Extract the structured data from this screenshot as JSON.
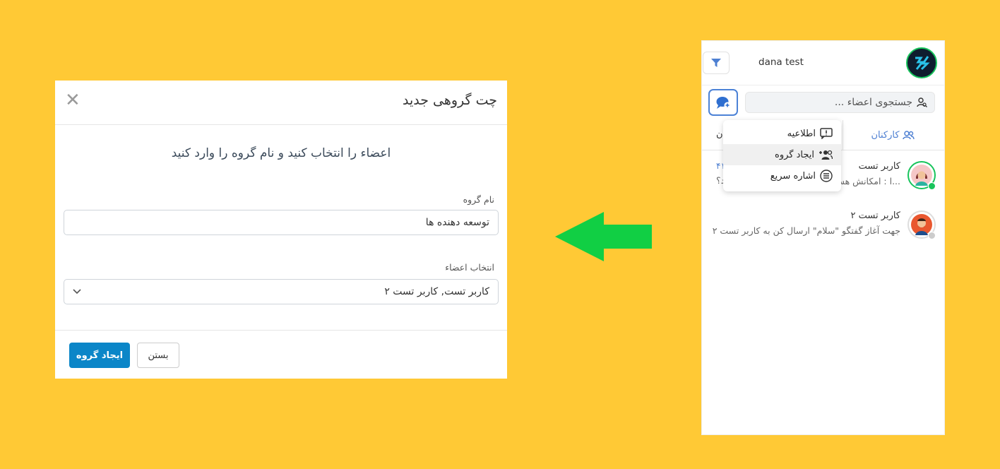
{
  "modal": {
    "title": "چت گروهی جدید",
    "instruction": "اعضاء را انتخاب کنید و نام گروه را وارد کنید",
    "group_name_label": "نام گروه",
    "group_name_value": "توسعه دهنده ها",
    "members_label": "انتخاب اعضاء",
    "members_value": "کاربر تست,  کاربر تست ۲",
    "create_button": "ایجاد گروه",
    "close_button": "بستن"
  },
  "panel": {
    "user_name": "dana test",
    "search_placeholder": "جستجوی اعضاء ...",
    "tab_staff": "کارکنان",
    "tab_other": "ن",
    "menu": [
      {
        "label": "اطلاعیه",
        "icon": "announcement-icon"
      },
      {
        "label": "ایجاد گروه",
        "icon": "add-group-icon"
      },
      {
        "label": "اشاره سریع",
        "icon": "list-icon"
      }
    ],
    "contacts": [
      {
        "name": "کاربر تست",
        "message": "...ا : امکانش هس",
        "extra_top": "۴۱",
        "extra_bottom": "د؟",
        "status": "online"
      },
      {
        "name": "کاربر تست ۲",
        "message": "جهت آغاز گفتگو \"سلام\" ارسال کن به کاربر تست ۲",
        "status": "offline"
      }
    ]
  },
  "colors": {
    "background": "#ffc935",
    "primary": "#0b86c8",
    "arrow": "#11cf44",
    "accent": "#4d7fd2",
    "online": "#18c45c"
  }
}
